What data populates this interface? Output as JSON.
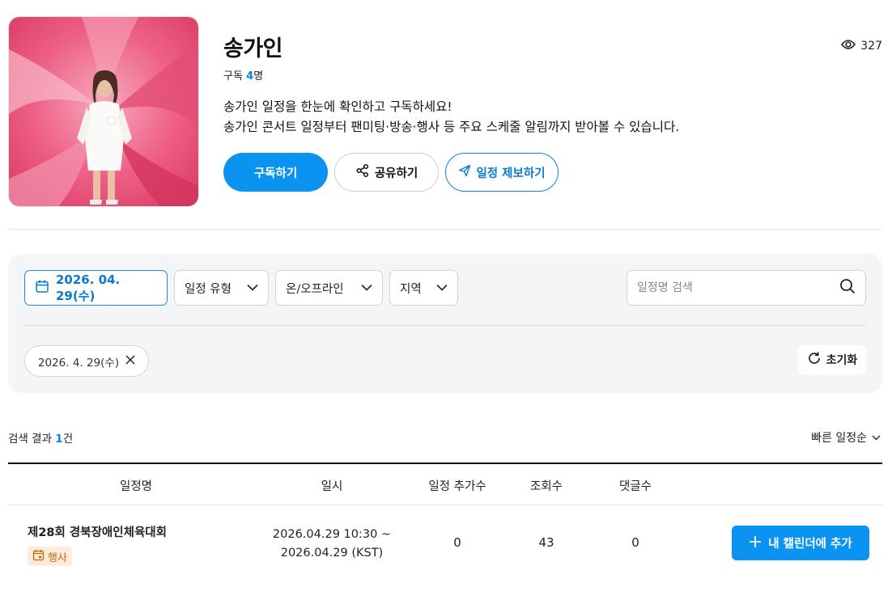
{
  "profile": {
    "name": "송가인",
    "subscriber_prefix": "구독",
    "subscriber_count": "4",
    "subscriber_suffix": "명",
    "view_count": "327",
    "description_line1": "송가인 일정을 한눈에 확인하고 구독하세요!",
    "description_line2": "송가인 콘서트 일정부터 팬미팅·방송·행사 등 주요 스케줄 알림까지 받아볼 수 있습니다.",
    "image_icon": "artist-photo"
  },
  "actions": {
    "subscribe_label": "구독하기",
    "share_label": "공유하기",
    "report_label": "일정 제보하기"
  },
  "filters": {
    "date_label": "2026. 04. 29(수)",
    "type_label": "일정 유형",
    "online_label": "온/오프라인",
    "region_label": "지역",
    "search_placeholder": "일정명 검색",
    "active_tag": "2026. 4. 29(수)",
    "reset_label": "초기화"
  },
  "results": {
    "count_prefix": "검색 결과",
    "count": "1",
    "count_suffix": "건",
    "sort_label": "빠른 일정순"
  },
  "table": {
    "headers": [
      "일정명",
      "일시",
      "일정 추가수",
      "조회수",
      "댓글수"
    ],
    "rows": [
      {
        "title": "제28회 경북장애인체육대회",
        "category": "행사",
        "date_line1": "2026.04.29 10:30 ~",
        "date_line2": "2026.04.29 (KST)",
        "adds": "0",
        "views": "43",
        "comments": "0",
        "add_button": "내 캘린더에 추가"
      }
    ]
  },
  "colors": {
    "accent": "#0a93f0",
    "accent_text": "#0a7ad0",
    "badge_bg": "#fdecd9",
    "badge_text": "#c26a10",
    "panel_bg": "#f3f5f7"
  }
}
